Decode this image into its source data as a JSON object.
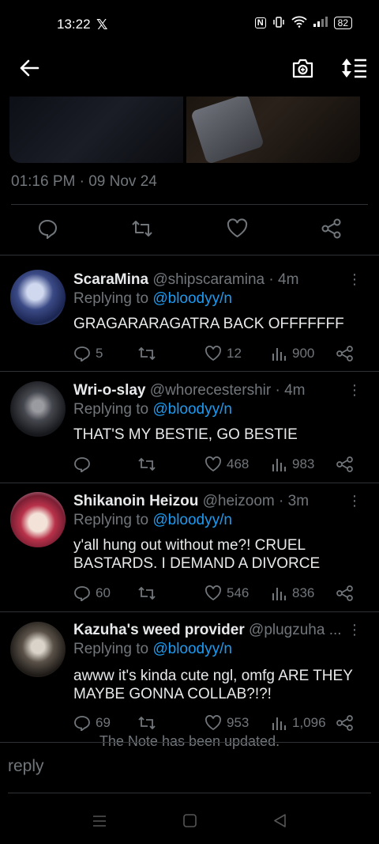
{
  "status_bar": {
    "time": "13:22",
    "app_icon": "x-logo-icon",
    "nfc": "N",
    "battery": "82"
  },
  "header": {
    "back_icon": "arrow-left-icon",
    "camera_icon": "camera-icon",
    "sort_icon": "sort-icon"
  },
  "post": {
    "timestamp": "01:16 PM · 09 Nov 24"
  },
  "replies": [
    {
      "name": "ScaraMina",
      "handle": "@shipscaramina · 4m",
      "replying_prefix": "Replying to ",
      "replying_to": "@bloodyy/n",
      "text": "GRAGARARAGATRA BACK OFFFFFFF",
      "replies": "5",
      "retweets": "",
      "likes": "12",
      "views": "900"
    },
    {
      "name": "Wri-o-slay",
      "handle": "@whorecestershir · 4m",
      "replying_prefix": "Replying to ",
      "replying_to": "@bloodyy/n",
      "text": "THAT'S MY BESTIE, GO BESTIE",
      "replies": "",
      "retweets": "",
      "likes": "468",
      "views": "983"
    },
    {
      "name": "Shikanoin Heizou",
      "handle": "@heizoom · 3m",
      "replying_prefix": "Replying to ",
      "replying_to": "@bloodyy/n",
      "text": "y'all hung out without me?! CRUEL BASTARDS. I DEMAND A DIVORCE",
      "replies": "60",
      "retweets": "",
      "likes": "546",
      "views": "836"
    },
    {
      "name": "Kazuha's weed provider",
      "handle": "@plugzuha ...",
      "replying_prefix": "Replying to ",
      "replying_to": "@bloodyy/n",
      "text": "awww it's kinda cute ngl, omfg ARE THEY MAYBE GONNA COLLAB?!?!",
      "replies": "69",
      "retweets": "",
      "likes": "953",
      "views": "1,096"
    }
  ],
  "toast": "The Note has been updated.",
  "reply_placeholder": "reply",
  "colors": {
    "accent": "#1d9bf0",
    "muted": "#71767b",
    "background": "#000000"
  }
}
